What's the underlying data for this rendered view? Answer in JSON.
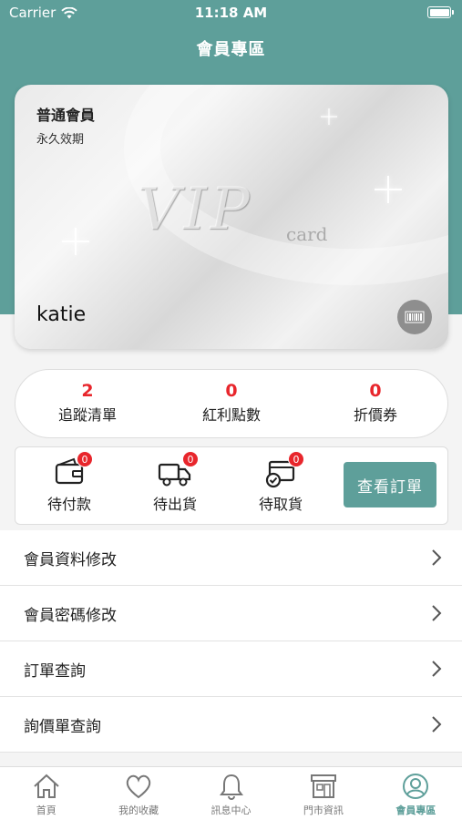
{
  "status_bar": {
    "carrier": "Carrier",
    "time": "11:18 AM"
  },
  "header": {
    "title": "會員專區"
  },
  "member_card": {
    "level": "普通會員",
    "validity": "永久效期",
    "logo_text": "VIP",
    "logo_sub": "card",
    "username": "katie"
  },
  "stats": [
    {
      "value": "2",
      "label": "追蹤清單"
    },
    {
      "value": "0",
      "label": "紅利點數"
    },
    {
      "value": "0",
      "label": "折價券"
    }
  ],
  "orders": {
    "items": [
      {
        "label": "待付款",
        "count": "0"
      },
      {
        "label": "待出貨",
        "count": "0"
      },
      {
        "label": "待取貨",
        "count": "0"
      }
    ],
    "view_button": "查看訂單"
  },
  "menu": [
    {
      "label": "會員資料修改"
    },
    {
      "label": "會員密碼修改"
    },
    {
      "label": "訂單查詢"
    },
    {
      "label": "詢價單查詢"
    }
  ],
  "tabbar": [
    {
      "label": "首頁",
      "icon": "home-icon"
    },
    {
      "label": "我的收藏",
      "icon": "heart-icon"
    },
    {
      "label": "訊息中心",
      "icon": "bell-icon"
    },
    {
      "label": "門市資訊",
      "icon": "store-icon"
    },
    {
      "label": "會員專區",
      "icon": "user-circle-icon",
      "active": true
    }
  ],
  "colors": {
    "accent": "#5e9f9a",
    "badge": "#e8262c"
  }
}
